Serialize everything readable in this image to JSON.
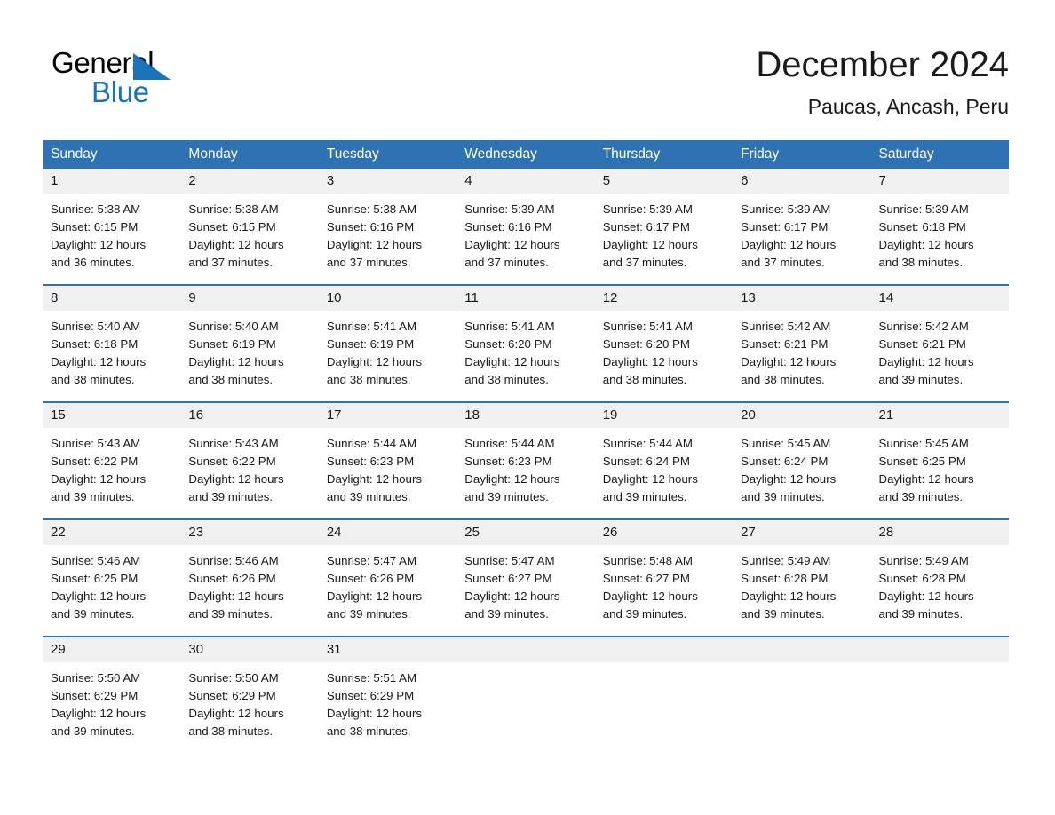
{
  "brand": {
    "name_part1": "General",
    "name_part2": "Blue",
    "triangle_icon": "triangle-icon",
    "accent_color": "#1a72b8"
  },
  "header": {
    "title": "December 2024",
    "subtitle": "Paucas, Ancash, Peru"
  },
  "theme": {
    "header_bg": "#2f72b4",
    "daynum_bg": "#f0f0f0",
    "divider": "#2f72b4",
    "text": "#1a1a1a"
  },
  "weekdays": [
    "Sunday",
    "Monday",
    "Tuesday",
    "Wednesday",
    "Thursday",
    "Friday",
    "Saturday"
  ],
  "weeks": [
    {
      "days": [
        {
          "num": "1",
          "sunrise": "Sunrise: 5:38 AM",
          "sunset": "Sunset: 6:15 PM",
          "daylight1": "Daylight: 12 hours",
          "daylight2": "and 36 minutes."
        },
        {
          "num": "2",
          "sunrise": "Sunrise: 5:38 AM",
          "sunset": "Sunset: 6:15 PM",
          "daylight1": "Daylight: 12 hours",
          "daylight2": "and 37 minutes."
        },
        {
          "num": "3",
          "sunrise": "Sunrise: 5:38 AM",
          "sunset": "Sunset: 6:16 PM",
          "daylight1": "Daylight: 12 hours",
          "daylight2": "and 37 minutes."
        },
        {
          "num": "4",
          "sunrise": "Sunrise: 5:39 AM",
          "sunset": "Sunset: 6:16 PM",
          "daylight1": "Daylight: 12 hours",
          "daylight2": "and 37 minutes."
        },
        {
          "num": "5",
          "sunrise": "Sunrise: 5:39 AM",
          "sunset": "Sunset: 6:17 PM",
          "daylight1": "Daylight: 12 hours",
          "daylight2": "and 37 minutes."
        },
        {
          "num": "6",
          "sunrise": "Sunrise: 5:39 AM",
          "sunset": "Sunset: 6:17 PM",
          "daylight1": "Daylight: 12 hours",
          "daylight2": "and 37 minutes."
        },
        {
          "num": "7",
          "sunrise": "Sunrise: 5:39 AM",
          "sunset": "Sunset: 6:18 PM",
          "daylight1": "Daylight: 12 hours",
          "daylight2": "and 38 minutes."
        }
      ]
    },
    {
      "days": [
        {
          "num": "8",
          "sunrise": "Sunrise: 5:40 AM",
          "sunset": "Sunset: 6:18 PM",
          "daylight1": "Daylight: 12 hours",
          "daylight2": "and 38 minutes."
        },
        {
          "num": "9",
          "sunrise": "Sunrise: 5:40 AM",
          "sunset": "Sunset: 6:19 PM",
          "daylight1": "Daylight: 12 hours",
          "daylight2": "and 38 minutes."
        },
        {
          "num": "10",
          "sunrise": "Sunrise: 5:41 AM",
          "sunset": "Sunset: 6:19 PM",
          "daylight1": "Daylight: 12 hours",
          "daylight2": "and 38 minutes."
        },
        {
          "num": "11",
          "sunrise": "Sunrise: 5:41 AM",
          "sunset": "Sunset: 6:20 PM",
          "daylight1": "Daylight: 12 hours",
          "daylight2": "and 38 minutes."
        },
        {
          "num": "12",
          "sunrise": "Sunrise: 5:41 AM",
          "sunset": "Sunset: 6:20 PM",
          "daylight1": "Daylight: 12 hours",
          "daylight2": "and 38 minutes."
        },
        {
          "num": "13",
          "sunrise": "Sunrise: 5:42 AM",
          "sunset": "Sunset: 6:21 PM",
          "daylight1": "Daylight: 12 hours",
          "daylight2": "and 38 minutes."
        },
        {
          "num": "14",
          "sunrise": "Sunrise: 5:42 AM",
          "sunset": "Sunset: 6:21 PM",
          "daylight1": "Daylight: 12 hours",
          "daylight2": "and 39 minutes."
        }
      ]
    },
    {
      "days": [
        {
          "num": "15",
          "sunrise": "Sunrise: 5:43 AM",
          "sunset": "Sunset: 6:22 PM",
          "daylight1": "Daylight: 12 hours",
          "daylight2": "and 39 minutes."
        },
        {
          "num": "16",
          "sunrise": "Sunrise: 5:43 AM",
          "sunset": "Sunset: 6:22 PM",
          "daylight1": "Daylight: 12 hours",
          "daylight2": "and 39 minutes."
        },
        {
          "num": "17",
          "sunrise": "Sunrise: 5:44 AM",
          "sunset": "Sunset: 6:23 PM",
          "daylight1": "Daylight: 12 hours",
          "daylight2": "and 39 minutes."
        },
        {
          "num": "18",
          "sunrise": "Sunrise: 5:44 AM",
          "sunset": "Sunset: 6:23 PM",
          "daylight1": "Daylight: 12 hours",
          "daylight2": "and 39 minutes."
        },
        {
          "num": "19",
          "sunrise": "Sunrise: 5:44 AM",
          "sunset": "Sunset: 6:24 PM",
          "daylight1": "Daylight: 12 hours",
          "daylight2": "and 39 minutes."
        },
        {
          "num": "20",
          "sunrise": "Sunrise: 5:45 AM",
          "sunset": "Sunset: 6:24 PM",
          "daylight1": "Daylight: 12 hours",
          "daylight2": "and 39 minutes."
        },
        {
          "num": "21",
          "sunrise": "Sunrise: 5:45 AM",
          "sunset": "Sunset: 6:25 PM",
          "daylight1": "Daylight: 12 hours",
          "daylight2": "and 39 minutes."
        }
      ]
    },
    {
      "days": [
        {
          "num": "22",
          "sunrise": "Sunrise: 5:46 AM",
          "sunset": "Sunset: 6:25 PM",
          "daylight1": "Daylight: 12 hours",
          "daylight2": "and 39 minutes."
        },
        {
          "num": "23",
          "sunrise": "Sunrise: 5:46 AM",
          "sunset": "Sunset: 6:26 PM",
          "daylight1": "Daylight: 12 hours",
          "daylight2": "and 39 minutes."
        },
        {
          "num": "24",
          "sunrise": "Sunrise: 5:47 AM",
          "sunset": "Sunset: 6:26 PM",
          "daylight1": "Daylight: 12 hours",
          "daylight2": "and 39 minutes."
        },
        {
          "num": "25",
          "sunrise": "Sunrise: 5:47 AM",
          "sunset": "Sunset: 6:27 PM",
          "daylight1": "Daylight: 12 hours",
          "daylight2": "and 39 minutes."
        },
        {
          "num": "26",
          "sunrise": "Sunrise: 5:48 AM",
          "sunset": "Sunset: 6:27 PM",
          "daylight1": "Daylight: 12 hours",
          "daylight2": "and 39 minutes."
        },
        {
          "num": "27",
          "sunrise": "Sunrise: 5:49 AM",
          "sunset": "Sunset: 6:28 PM",
          "daylight1": "Daylight: 12 hours",
          "daylight2": "and 39 minutes."
        },
        {
          "num": "28",
          "sunrise": "Sunrise: 5:49 AM",
          "sunset": "Sunset: 6:28 PM",
          "daylight1": "Daylight: 12 hours",
          "daylight2": "and 39 minutes."
        }
      ]
    },
    {
      "days": [
        {
          "num": "29",
          "sunrise": "Sunrise: 5:50 AM",
          "sunset": "Sunset: 6:29 PM",
          "daylight1": "Daylight: 12 hours",
          "daylight2": "and 39 minutes."
        },
        {
          "num": "30",
          "sunrise": "Sunrise: 5:50 AM",
          "sunset": "Sunset: 6:29 PM",
          "daylight1": "Daylight: 12 hours",
          "daylight2": "and 38 minutes."
        },
        {
          "num": "31",
          "sunrise": "Sunrise: 5:51 AM",
          "sunset": "Sunset: 6:29 PM",
          "daylight1": "Daylight: 12 hours",
          "daylight2": "and 38 minutes."
        },
        {
          "num": "",
          "sunrise": "",
          "sunset": "",
          "daylight1": "",
          "daylight2": ""
        },
        {
          "num": "",
          "sunrise": "",
          "sunset": "",
          "daylight1": "",
          "daylight2": ""
        },
        {
          "num": "",
          "sunrise": "",
          "sunset": "",
          "daylight1": "",
          "daylight2": ""
        },
        {
          "num": "",
          "sunrise": "",
          "sunset": "",
          "daylight1": "",
          "daylight2": ""
        }
      ]
    }
  ]
}
